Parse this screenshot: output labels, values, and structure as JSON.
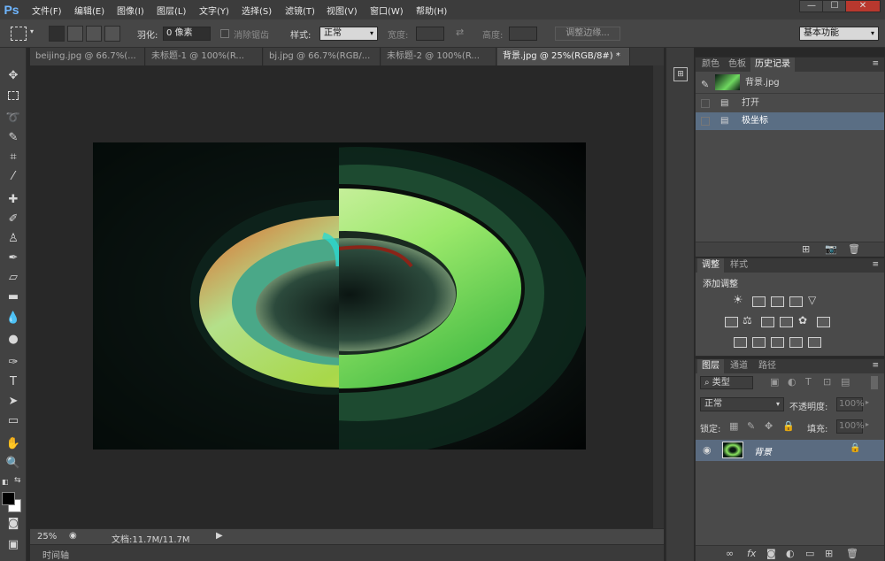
{
  "app": {
    "logo": "Ps"
  },
  "menu": [
    "文件(F)",
    "编辑(E)",
    "图像(I)",
    "图层(L)",
    "文字(Y)",
    "选择(S)",
    "滤镜(T)",
    "视图(V)",
    "窗口(W)",
    "帮助(H)"
  ],
  "window_controls": {
    "minimize": "—",
    "maximize": "☐",
    "close": "✕"
  },
  "options": {
    "feather_label": "羽化:",
    "feather_value": "0 像素",
    "antialias_label": "消除锯齿",
    "style_label": "样式:",
    "style_value": "正常",
    "width_label": "宽度:",
    "height_label": "高度:",
    "refine_edge": "调整边缘...",
    "workspace": "基本功能"
  },
  "doc_tabs": [
    {
      "label": "beijing.jpg @ 66.7%(...",
      "active": false
    },
    {
      "label": "未标题-1 @ 100%(R...",
      "active": false
    },
    {
      "label": "bj.jpg @ 66.7%(RGB/...",
      "active": false
    },
    {
      "label": "未标题-2 @ 100%(R...",
      "active": false
    },
    {
      "label": "背景.jpg @ 25%(RGB/8#) *",
      "active": true
    }
  ],
  "status": {
    "zoom": "25%",
    "doc_info": "文档:11.7M/11.7M"
  },
  "timeline_label": "时间轴",
  "history_panel": {
    "tabs": [
      "颜色",
      "色板",
      "历史记录"
    ],
    "snapshot": "背景.jpg",
    "items": [
      {
        "label": "打开",
        "selected": false
      },
      {
        "label": "极坐标",
        "selected": true
      }
    ]
  },
  "adjust_panel": {
    "tabs": [
      "调整",
      "样式"
    ],
    "title": "添加调整"
  },
  "layers_panel": {
    "tabs": [
      "图层",
      "通道",
      "路径"
    ],
    "filter_label": "类型",
    "blend_mode": "正常",
    "opacity_label": "不透明度:",
    "opacity_value": "100%",
    "lock_label": "锁定:",
    "fill_label": "填充:",
    "fill_value": "100%",
    "layer_name": "背景"
  },
  "colors": {
    "selected_row": "#5a6e84",
    "layer_row": "#5a6b80",
    "accent": "#6fb6ff"
  }
}
